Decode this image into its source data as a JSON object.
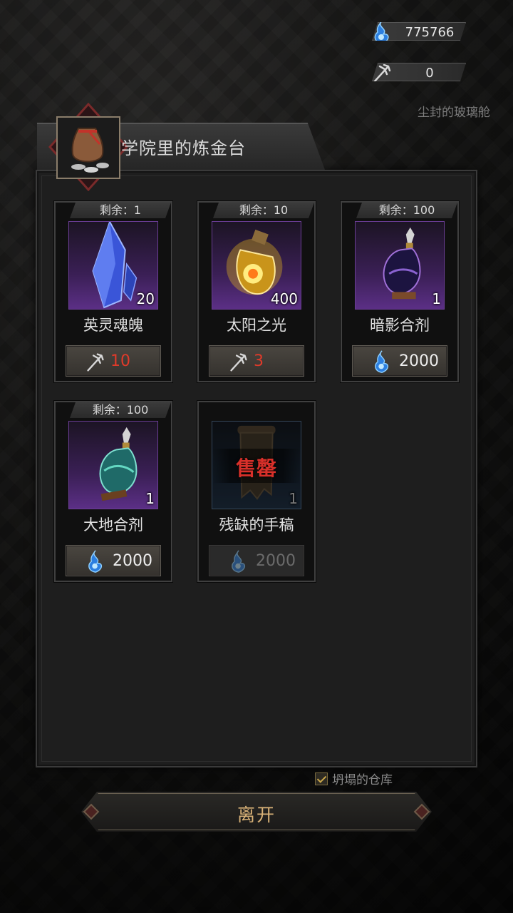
{
  "currencies": {
    "soul": {
      "icon": "blue-soul-flame-icon",
      "value": "775766"
    },
    "trident": {
      "icon": "silver-trident-icon",
      "value": "0"
    }
  },
  "location": "尘封的玻璃舱",
  "shop": {
    "title": "学院里的炼金台",
    "items": [
      {
        "stock": "剩余：1",
        "qty": "20",
        "name": "英灵魂魄",
        "price": "10",
        "currency": "trident",
        "sold_out": false
      },
      {
        "stock": "剩余：10",
        "qty": "400",
        "name": "太阳之光",
        "price": "3",
        "currency": "trident",
        "sold_out": false
      },
      {
        "stock": "剩余：100",
        "qty": "1",
        "name": "暗影合剂",
        "price": "2000",
        "currency": "soul",
        "sold_out": false
      },
      {
        "stock": "剩余：100",
        "qty": "1",
        "name": "大地合剂",
        "price": "2000",
        "currency": "soul",
        "sold_out": false
      },
      {
        "stock": "",
        "qty": "1",
        "name": "残缺的手稿",
        "price": "2000",
        "currency": "soul",
        "sold_out": true,
        "sold_out_label": "售罄"
      }
    ]
  },
  "warehouse_label": "坍塌的仓库",
  "leave_label": "离开",
  "colors": {
    "accent_gold": "#d9b278",
    "price_red": "#e03a2a",
    "sold_red": "#d8302a"
  }
}
